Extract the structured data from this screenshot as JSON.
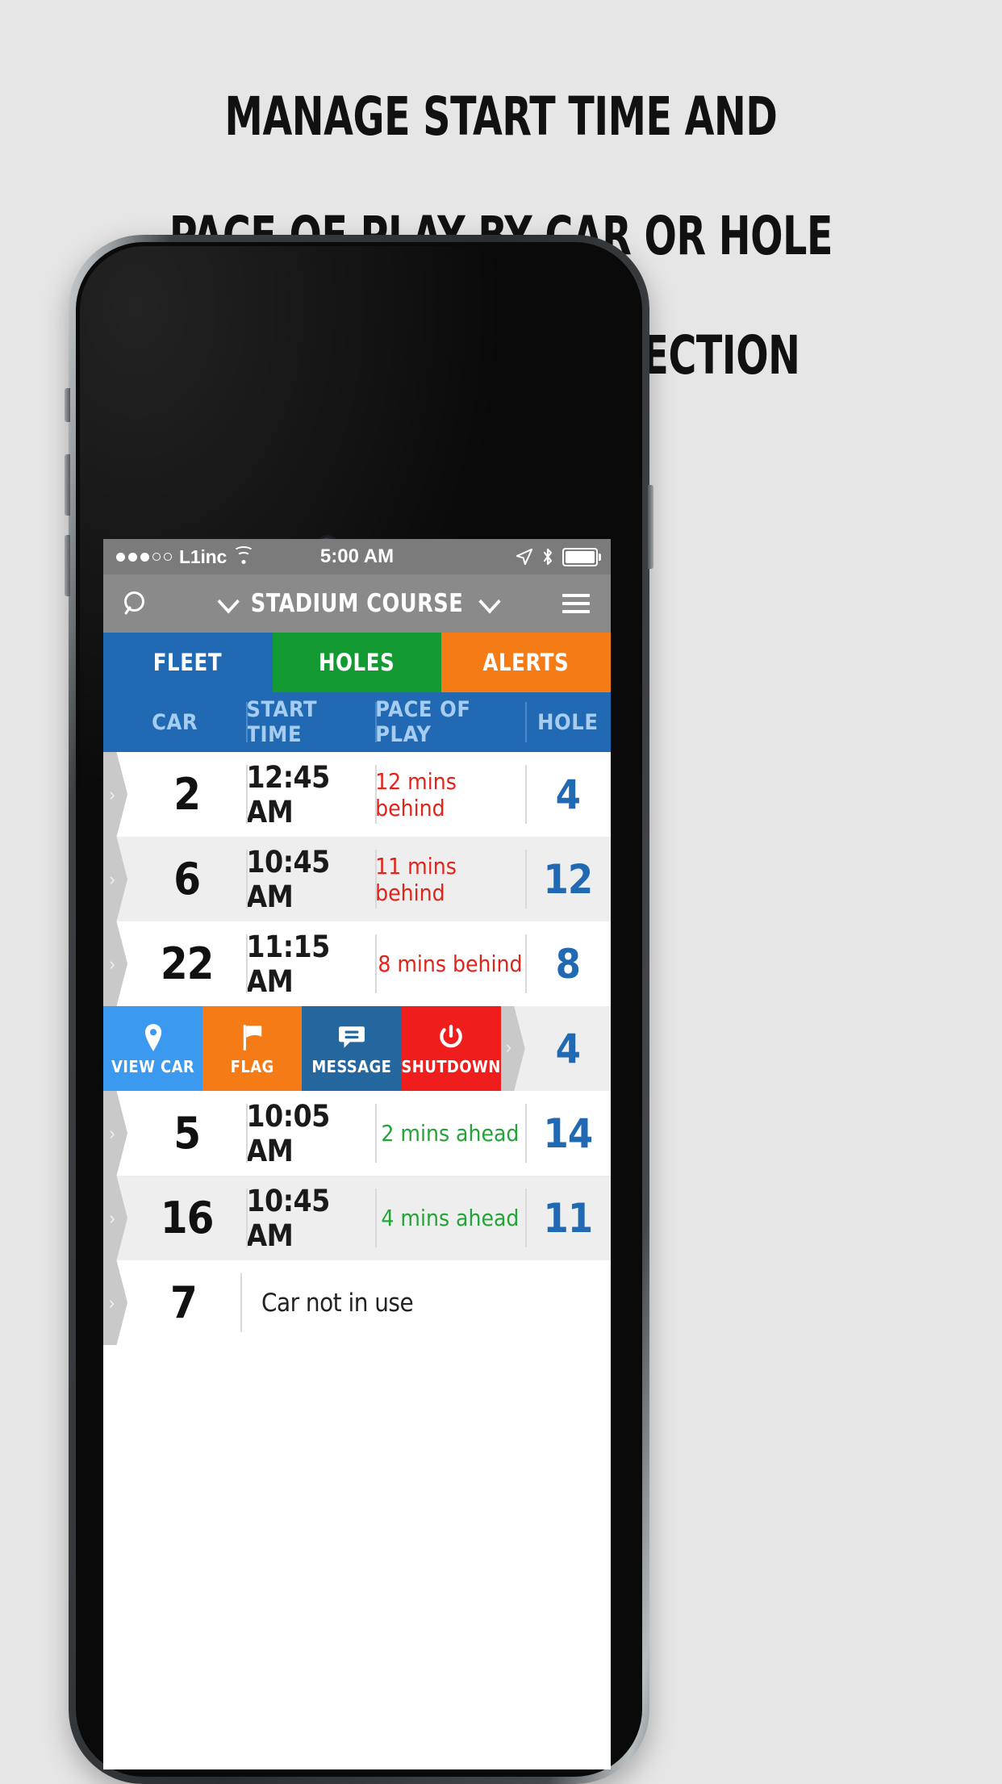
{
  "headline": {
    "line1": "MANAGE START TIME AND",
    "line2": "PACE OF PLAY BY CAR OR HOLE",
    "line3": "WITH THE “FLEET” SECTION"
  },
  "status_bar": {
    "carrier": "L1inc",
    "time": "5:00 AM",
    "signal_dots_filled": 3,
    "signal_dots_total": 5,
    "wifi_icon": "wifi-icon",
    "location_icon": "location-arrow-icon",
    "bluetooth_icon": "bluetooth-icon",
    "battery_icon": "battery-full-icon"
  },
  "nav_bar": {
    "search_icon": "search-icon",
    "left_chevron": "chevron-down-icon",
    "title": "STADIUM COURSE",
    "right_chevron": "chevron-down-icon",
    "menu_icon": "hamburger-menu-icon"
  },
  "tabs": [
    {
      "label": "FLEET",
      "color": "#2169b3",
      "active": true
    },
    {
      "label": "HOLES",
      "color": "#139a32",
      "active": false
    },
    {
      "label": "ALERTS",
      "color": "#f47b16",
      "active": false
    }
  ],
  "columns": [
    {
      "label": "CAR"
    },
    {
      "label": "START TIME"
    },
    {
      "label": "PACE OF PLAY"
    },
    {
      "label": "HOLE"
    }
  ],
  "rows": [
    {
      "type": "data",
      "car": "2",
      "start_time": "12:45 AM",
      "pace": "12 mins behind",
      "pace_state": "behind",
      "hole": "4",
      "shade": "odd"
    },
    {
      "type": "data",
      "car": "6",
      "start_time": "10:45 AM",
      "pace": "11 mins behind",
      "pace_state": "behind",
      "hole": "12",
      "shade": "even"
    },
    {
      "type": "data",
      "car": "22",
      "start_time": "11:15 AM",
      "pace": "8 mins behind",
      "pace_state": "behind",
      "hole": "8",
      "shade": "odd"
    },
    {
      "type": "actions",
      "hole": "4",
      "shade": "even"
    },
    {
      "type": "data",
      "car": "5",
      "start_time": "10:05 AM",
      "pace": "2 mins ahead",
      "pace_state": "ahead",
      "hole": "14",
      "shade": "odd"
    },
    {
      "type": "data",
      "car": "16",
      "start_time": "10:45 AM",
      "pace": "4 mins ahead",
      "pace_state": "ahead",
      "hole": "11",
      "shade": "even"
    },
    {
      "type": "idle",
      "car": "7",
      "start_time": "Car not in use",
      "pace": "",
      "pace_state": "none",
      "hole": "",
      "shade": "odd"
    }
  ],
  "swipe_actions": [
    {
      "label": "VIEW CAR",
      "icon": "map-pin-icon",
      "color": "#3b99f0"
    },
    {
      "label": "FLAG",
      "icon": "flag-icon",
      "color": "#f47b16"
    },
    {
      "label": "MESSAGE",
      "icon": "chat-bubble-icon",
      "color": "#24679f"
    },
    {
      "label": "SHUTDOWN",
      "icon": "power-icon",
      "color": "#f01d1d"
    }
  ],
  "colors": {
    "blue": "#2169b3",
    "green": "#139a32",
    "orange": "#f47b16",
    "red": "#e2231a",
    "ahead_green": "#23a338",
    "header_text_blue": "#a6cdf0",
    "page_background": "#e6e6e6"
  }
}
